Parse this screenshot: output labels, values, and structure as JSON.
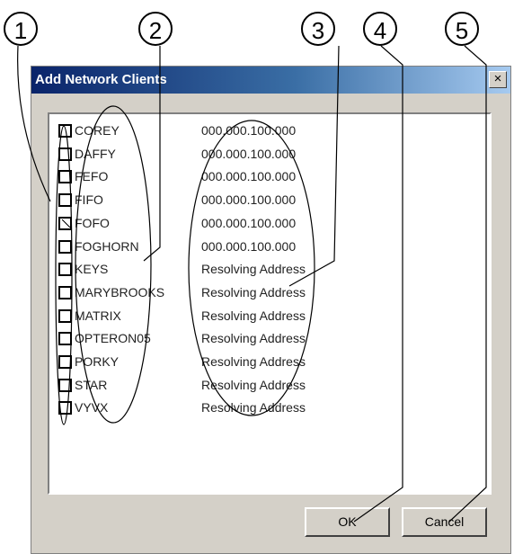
{
  "callouts": [
    "1",
    "2",
    "3",
    "4",
    "5"
  ],
  "dialog": {
    "title": "Add Network Clients",
    "close_label": "×",
    "clients": [
      {
        "name": "COREY",
        "address": "000.000.100.000",
        "checked": false
      },
      {
        "name": "DAFFY",
        "address": "000.000.100.000",
        "checked": false
      },
      {
        "name": "FEFO",
        "address": "000.000.100.000",
        "checked": false
      },
      {
        "name": "FIFO",
        "address": "000.000.100.000",
        "checked": false
      },
      {
        "name": "FOFO",
        "address": "000.000.100.000",
        "checked": true
      },
      {
        "name": "FOGHORN",
        "address": "000.000.100.000",
        "checked": false
      },
      {
        "name": "KEYS",
        "address": "Resolving Address",
        "checked": false
      },
      {
        "name": "MARYBROOKS",
        "address": "Resolving Address",
        "checked": false
      },
      {
        "name": "MATRIX",
        "address": "Resolving Address",
        "checked": false
      },
      {
        "name": "OPTERON05",
        "address": "Resolving Address",
        "checked": false
      },
      {
        "name": "PORKY",
        "address": "Resolving Address",
        "checked": false
      },
      {
        "name": "STAR",
        "address": "Resolving Address",
        "checked": false
      },
      {
        "name": "VYVX",
        "address": "Resolving Address",
        "checked": false
      }
    ],
    "ok_label": "OK",
    "cancel_label": "Cancel"
  }
}
